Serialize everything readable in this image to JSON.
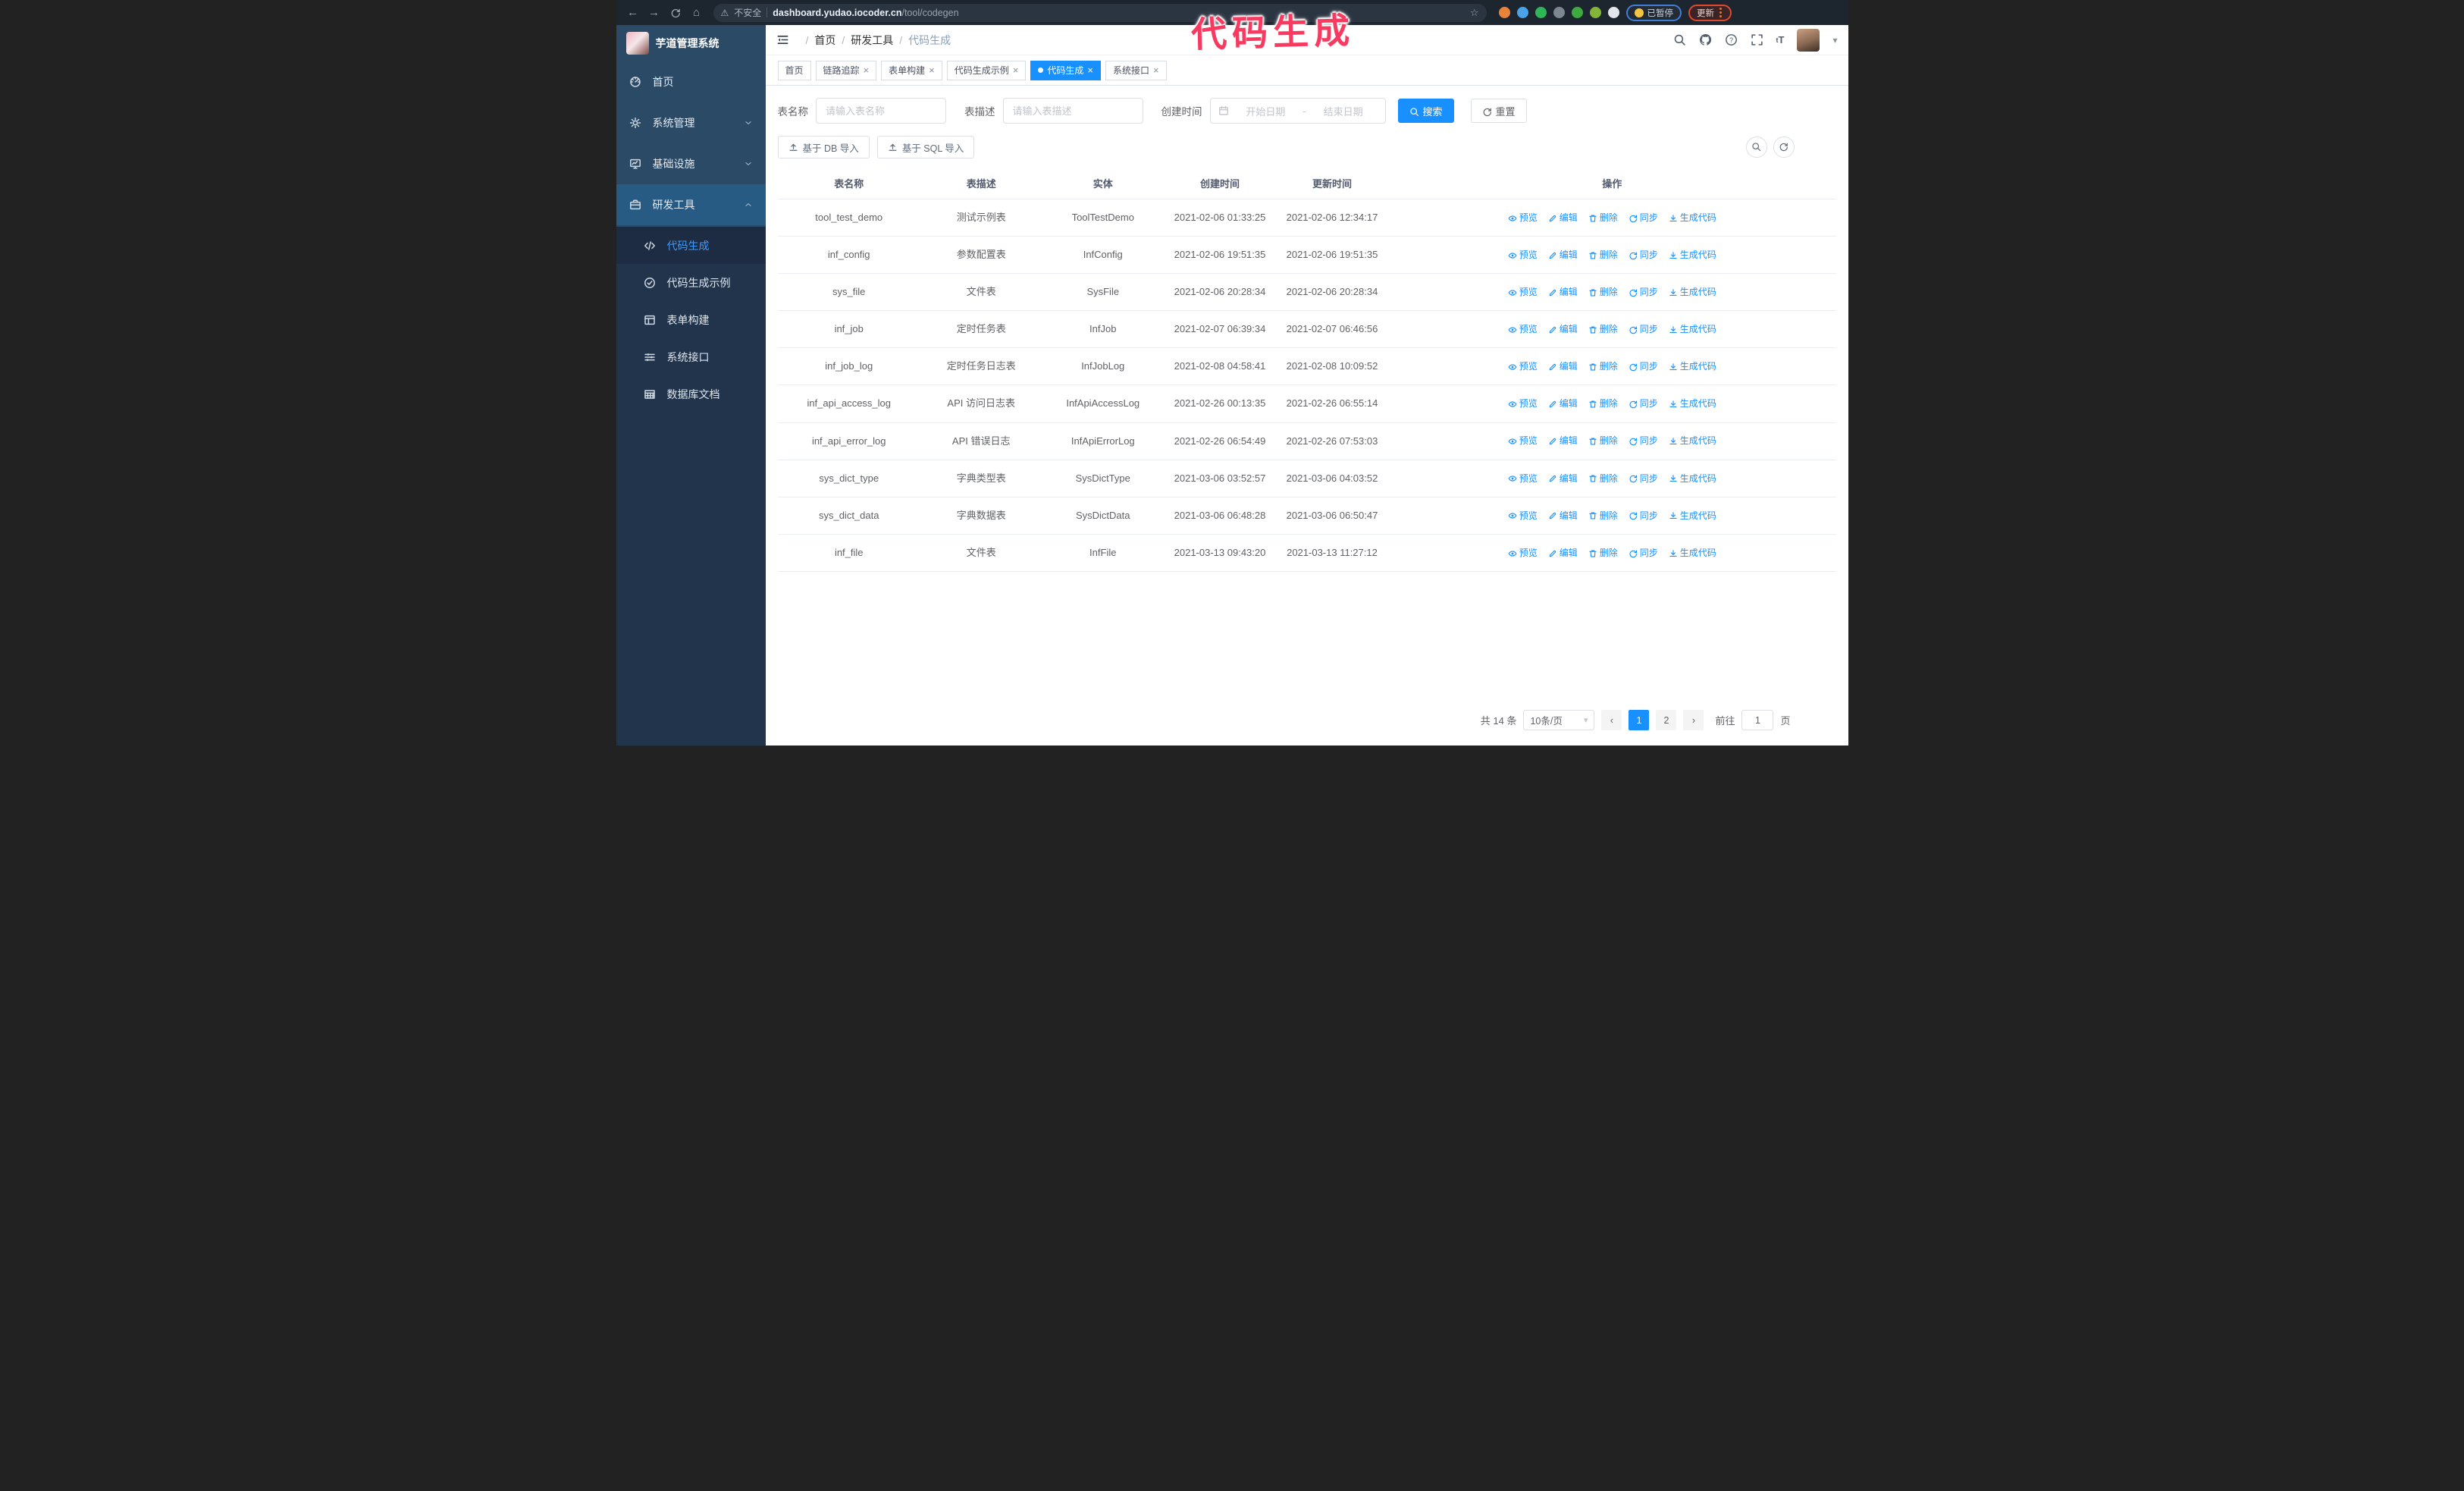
{
  "colors": {
    "accent": "#1890ff",
    "annotation": "#f73b60",
    "sidebar": "#2b4a66",
    "submenu_bg": "#22344c",
    "chrome_bg": "#1d252f"
  },
  "annotation": {
    "text": "代码生成",
    "color": "#f73b60"
  },
  "browser": {
    "security_label": "不安全",
    "url_domain": "dashboard.yudao.iocoder.cn",
    "url_path": "/tool/codegen",
    "paused_badge": "已暂停",
    "update_label": "更新",
    "extensions": [
      {
        "name": "extension-icon",
        "color": "#e8833a"
      },
      {
        "name": "extension-icon",
        "color": "#4aa3e8"
      },
      {
        "name": "extension-icon",
        "color": "#2fb457"
      },
      {
        "name": "extension-icon",
        "color": "#7d8794"
      },
      {
        "name": "extension-icon",
        "color": "#3faa3f"
      },
      {
        "name": "extension-icon",
        "color": "#84b33a"
      },
      {
        "name": "extension-icon",
        "color": "#e3e6ea"
      }
    ]
  },
  "sidebar": {
    "title": "芋道管理系统",
    "menu": [
      {
        "label": "首页",
        "icon": "dashboard-icon"
      },
      {
        "label": "系统管理",
        "icon": "gear-icon",
        "chevron": "down"
      },
      {
        "label": "基础设施",
        "icon": "monitor-icon",
        "chevron": "down"
      },
      {
        "label": "研发工具",
        "icon": "toolbox-icon",
        "chevron": "up",
        "expanded": true
      }
    ],
    "submenu": [
      {
        "label": "代码生成",
        "icon": "code-icon",
        "active": true
      },
      {
        "label": "代码生成示例",
        "icon": "example-icon"
      },
      {
        "label": "表单构建",
        "icon": "form-icon"
      },
      {
        "label": "系统接口",
        "icon": "api-icon"
      },
      {
        "label": "数据库文档",
        "icon": "db-doc-icon"
      }
    ]
  },
  "header": {
    "breadcrumb": [
      {
        "label": "首页"
      },
      {
        "label": "研发工具"
      },
      {
        "label": "代码生成",
        "current": true
      }
    ],
    "icons": [
      "search-icon",
      "github-icon",
      "question-icon",
      "fullscreen-icon",
      "font-size-icon"
    ]
  },
  "tabs": [
    {
      "label": "首页",
      "closable": false
    },
    {
      "label": "链路追踪",
      "closable": true
    },
    {
      "label": "表单构建",
      "closable": true
    },
    {
      "label": "代码生成示例",
      "closable": true
    },
    {
      "label": "代码生成",
      "closable": true,
      "active": true
    },
    {
      "label": "系统接口",
      "closable": true
    }
  ],
  "search": {
    "name_label": "表名称",
    "name_placeholder": "请输入表名称",
    "desc_label": "表描述",
    "desc_placeholder": "请输入表描述",
    "time_label": "创建时间",
    "start_placeholder": "开始日期",
    "range_separator": "-",
    "end_placeholder": "结束日期",
    "search_button": "搜索",
    "reset_button": "重置"
  },
  "toolbar": {
    "db_import": "基于 DB 导入",
    "sql_import": "基于 SQL 导入"
  },
  "table": {
    "columns": [
      "表名称",
      "表描述",
      "实体",
      "创建时间",
      "更新时间",
      "操作"
    ],
    "actions": [
      {
        "name": "preview-link",
        "label": "预览",
        "icon": "eye-icon"
      },
      {
        "name": "edit-link",
        "label": "编辑",
        "icon": "edit-icon"
      },
      {
        "name": "delete-link",
        "label": "删除",
        "icon": "delete-icon"
      },
      {
        "name": "sync-link",
        "label": "同步",
        "icon": "sync-icon"
      },
      {
        "name": "generate-code-link",
        "label": "生成代码",
        "icon": "download-icon"
      }
    ],
    "rows": [
      {
        "name": "tool_test_demo",
        "desc": "测试示例表",
        "entity": "ToolTestDemo",
        "created": "2021-02-06 01:33:25",
        "updated": "2021-02-06 12:34:17"
      },
      {
        "name": "inf_config",
        "desc": "参数配置表",
        "entity": "InfConfig",
        "created": "2021-02-06 19:51:35",
        "updated": "2021-02-06 19:51:35"
      },
      {
        "name": "sys_file",
        "desc": "文件表",
        "entity": "SysFile",
        "created": "2021-02-06 20:28:34",
        "updated": "2021-02-06 20:28:34"
      },
      {
        "name": "inf_job",
        "desc": "定时任务表",
        "entity": "InfJob",
        "created": "2021-02-07 06:39:34",
        "updated": "2021-02-07 06:46:56"
      },
      {
        "name": "inf_job_log",
        "desc": "定时任务日志表",
        "entity": "InfJobLog",
        "created": "2021-02-08 04:58:41",
        "updated": "2021-02-08 10:09:52"
      },
      {
        "name": "inf_api_access_log",
        "desc": "API 访问日志表",
        "entity": "InfApiAccessLog",
        "created": "2021-02-26 00:13:35",
        "updated": "2021-02-26 06:55:14"
      },
      {
        "name": "inf_api_error_log",
        "desc": "API 错误日志",
        "entity": "InfApiErrorLog",
        "created": "2021-02-26 06:54:49",
        "updated": "2021-02-26 07:53:03"
      },
      {
        "name": "sys_dict_type",
        "desc": "字典类型表",
        "entity": "SysDictType",
        "created": "2021-03-06 03:52:57",
        "updated": "2021-03-06 04:03:52"
      },
      {
        "name": "sys_dict_data",
        "desc": "字典数据表",
        "entity": "SysDictData",
        "created": "2021-03-06 06:48:28",
        "updated": "2021-03-06 06:50:47"
      },
      {
        "name": "inf_file",
        "desc": "文件表",
        "entity": "InfFile",
        "created": "2021-03-13 09:43:20",
        "updated": "2021-03-13 11:27:12"
      }
    ]
  },
  "pagination": {
    "total": "共 14 条",
    "page_size": "10条/页",
    "pages": [
      {
        "label": "1",
        "active": true
      },
      {
        "label": "2"
      }
    ],
    "goto_label": "前往",
    "goto_value": "1",
    "goto_suffix": "页"
  }
}
